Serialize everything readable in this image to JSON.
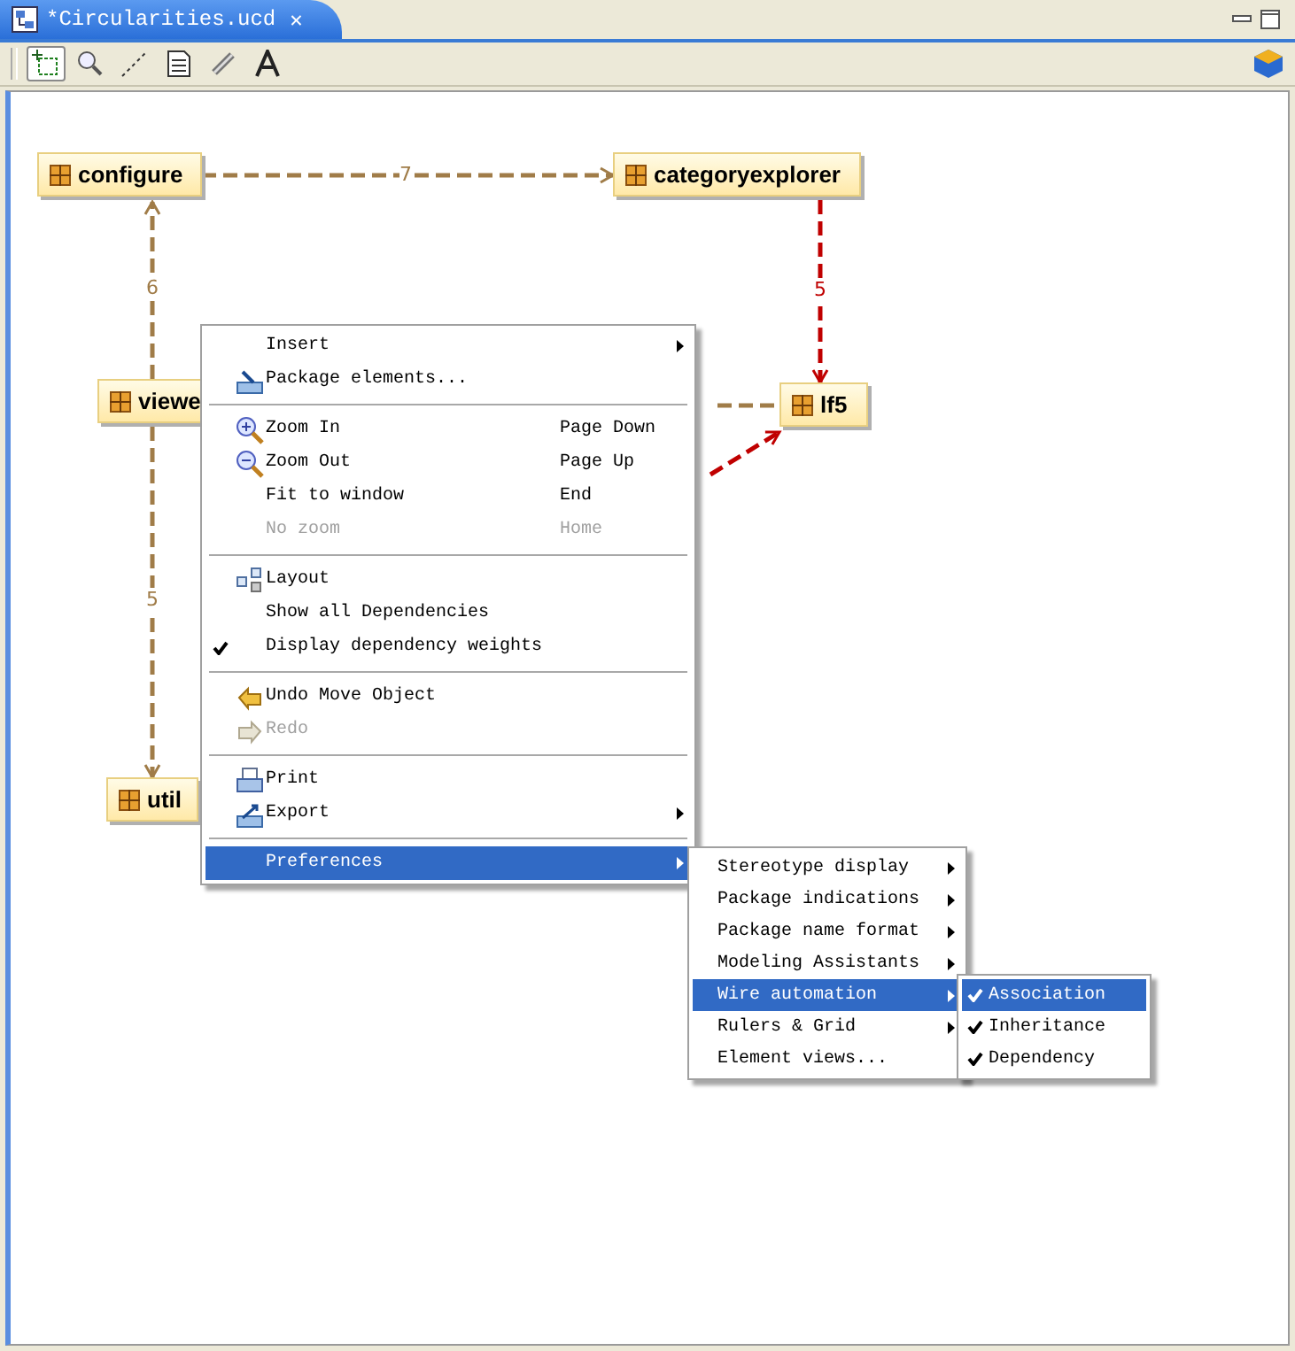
{
  "tab": {
    "title": "*Circularities.ucd",
    "selected": true,
    "close": "✕"
  },
  "toolbar": [
    {
      "selected": true
    },
    {
      "selected": false
    },
    {
      "selected": false
    },
    {
      "selected": false
    },
    {
      "selected": false
    },
    {
      "selected": false
    }
  ],
  "nodes": [
    {
      "name": "configure"
    },
    {
      "name": "categoryexplorer"
    },
    {
      "name": "viewe"
    },
    {
      "name": "lf5"
    },
    {
      "name": "util"
    }
  ],
  "edges": [
    {
      "label": "7",
      "color": "#a07c48"
    },
    {
      "label": "6",
      "color": "#a07c48"
    },
    {
      "label": "5",
      "color": "#c00000"
    },
    {
      "label": "5",
      "color": "#a07c48"
    },
    {
      "color": "#a07c48"
    },
    {
      "color": "#c00000"
    }
  ],
  "context_menu": {
    "sections": [
      [
        {
          "label": "Insert",
          "submenu": true,
          "checked": false,
          "disabled": false,
          "selected": false
        },
        {
          "label": "Package elements...",
          "submenu": false,
          "checked": false,
          "disabled": false,
          "selected": false
        }
      ],
      [
        {
          "label": "Zoom In",
          "shortcut": "Page Down",
          "submenu": false,
          "checked": false,
          "disabled": false,
          "selected": false
        },
        {
          "label": "Zoom Out",
          "shortcut": "Page Up",
          "submenu": false,
          "checked": false,
          "disabled": false,
          "selected": false
        },
        {
          "label": "Fit to window",
          "shortcut": "End",
          "submenu": false,
          "checked": false,
          "disabled": false,
          "selected": false
        },
        {
          "label": "No zoom",
          "shortcut": "Home",
          "submenu": false,
          "checked": false,
          "disabled": true,
          "selected": false
        }
      ],
      [
        {
          "label": "Layout",
          "submenu": false,
          "checked": false,
          "disabled": false,
          "selected": false
        },
        {
          "label": "Show all Dependencies",
          "submenu": false,
          "checked": false,
          "disabled": false,
          "selected": false
        },
        {
          "label": "Display dependency weights",
          "submenu": false,
          "checked": true,
          "disabled": false,
          "selected": false
        }
      ],
      [
        {
          "label": "Undo Move Object",
          "submenu": false,
          "checked": false,
          "disabled": false,
          "selected": false
        },
        {
          "label": "Redo",
          "submenu": false,
          "checked": false,
          "disabled": true,
          "selected": false
        }
      ],
      [
        {
          "label": "Print",
          "submenu": false,
          "checked": false,
          "disabled": false,
          "selected": false
        },
        {
          "label": "Export",
          "submenu": true,
          "checked": false,
          "disabled": false,
          "selected": false
        }
      ],
      [
        {
          "label": "Preferences",
          "submenu": true,
          "checked": false,
          "disabled": false,
          "selected": true
        }
      ]
    ]
  },
  "preferences_menu": [
    {
      "label": "Stereotype display",
      "submenu": true,
      "selected": false
    },
    {
      "label": "Package indications",
      "submenu": true,
      "selected": false
    },
    {
      "label": "Package name format",
      "submenu": true,
      "selected": false
    },
    {
      "label": "Modeling Assistants",
      "submenu": true,
      "selected": false
    },
    {
      "label": "Wire automation",
      "submenu": true,
      "selected": true
    },
    {
      "label": "Rulers & Grid",
      "submenu": true,
      "selected": false
    },
    {
      "label": "Element views...",
      "submenu": false,
      "selected": false
    }
  ],
  "wire_automation_menu": [
    {
      "label": "Association",
      "checked": true,
      "selected": true
    },
    {
      "label": "Inheritance",
      "checked": true,
      "selected": false
    },
    {
      "label": "Dependency",
      "checked": true,
      "selected": false
    }
  ]
}
